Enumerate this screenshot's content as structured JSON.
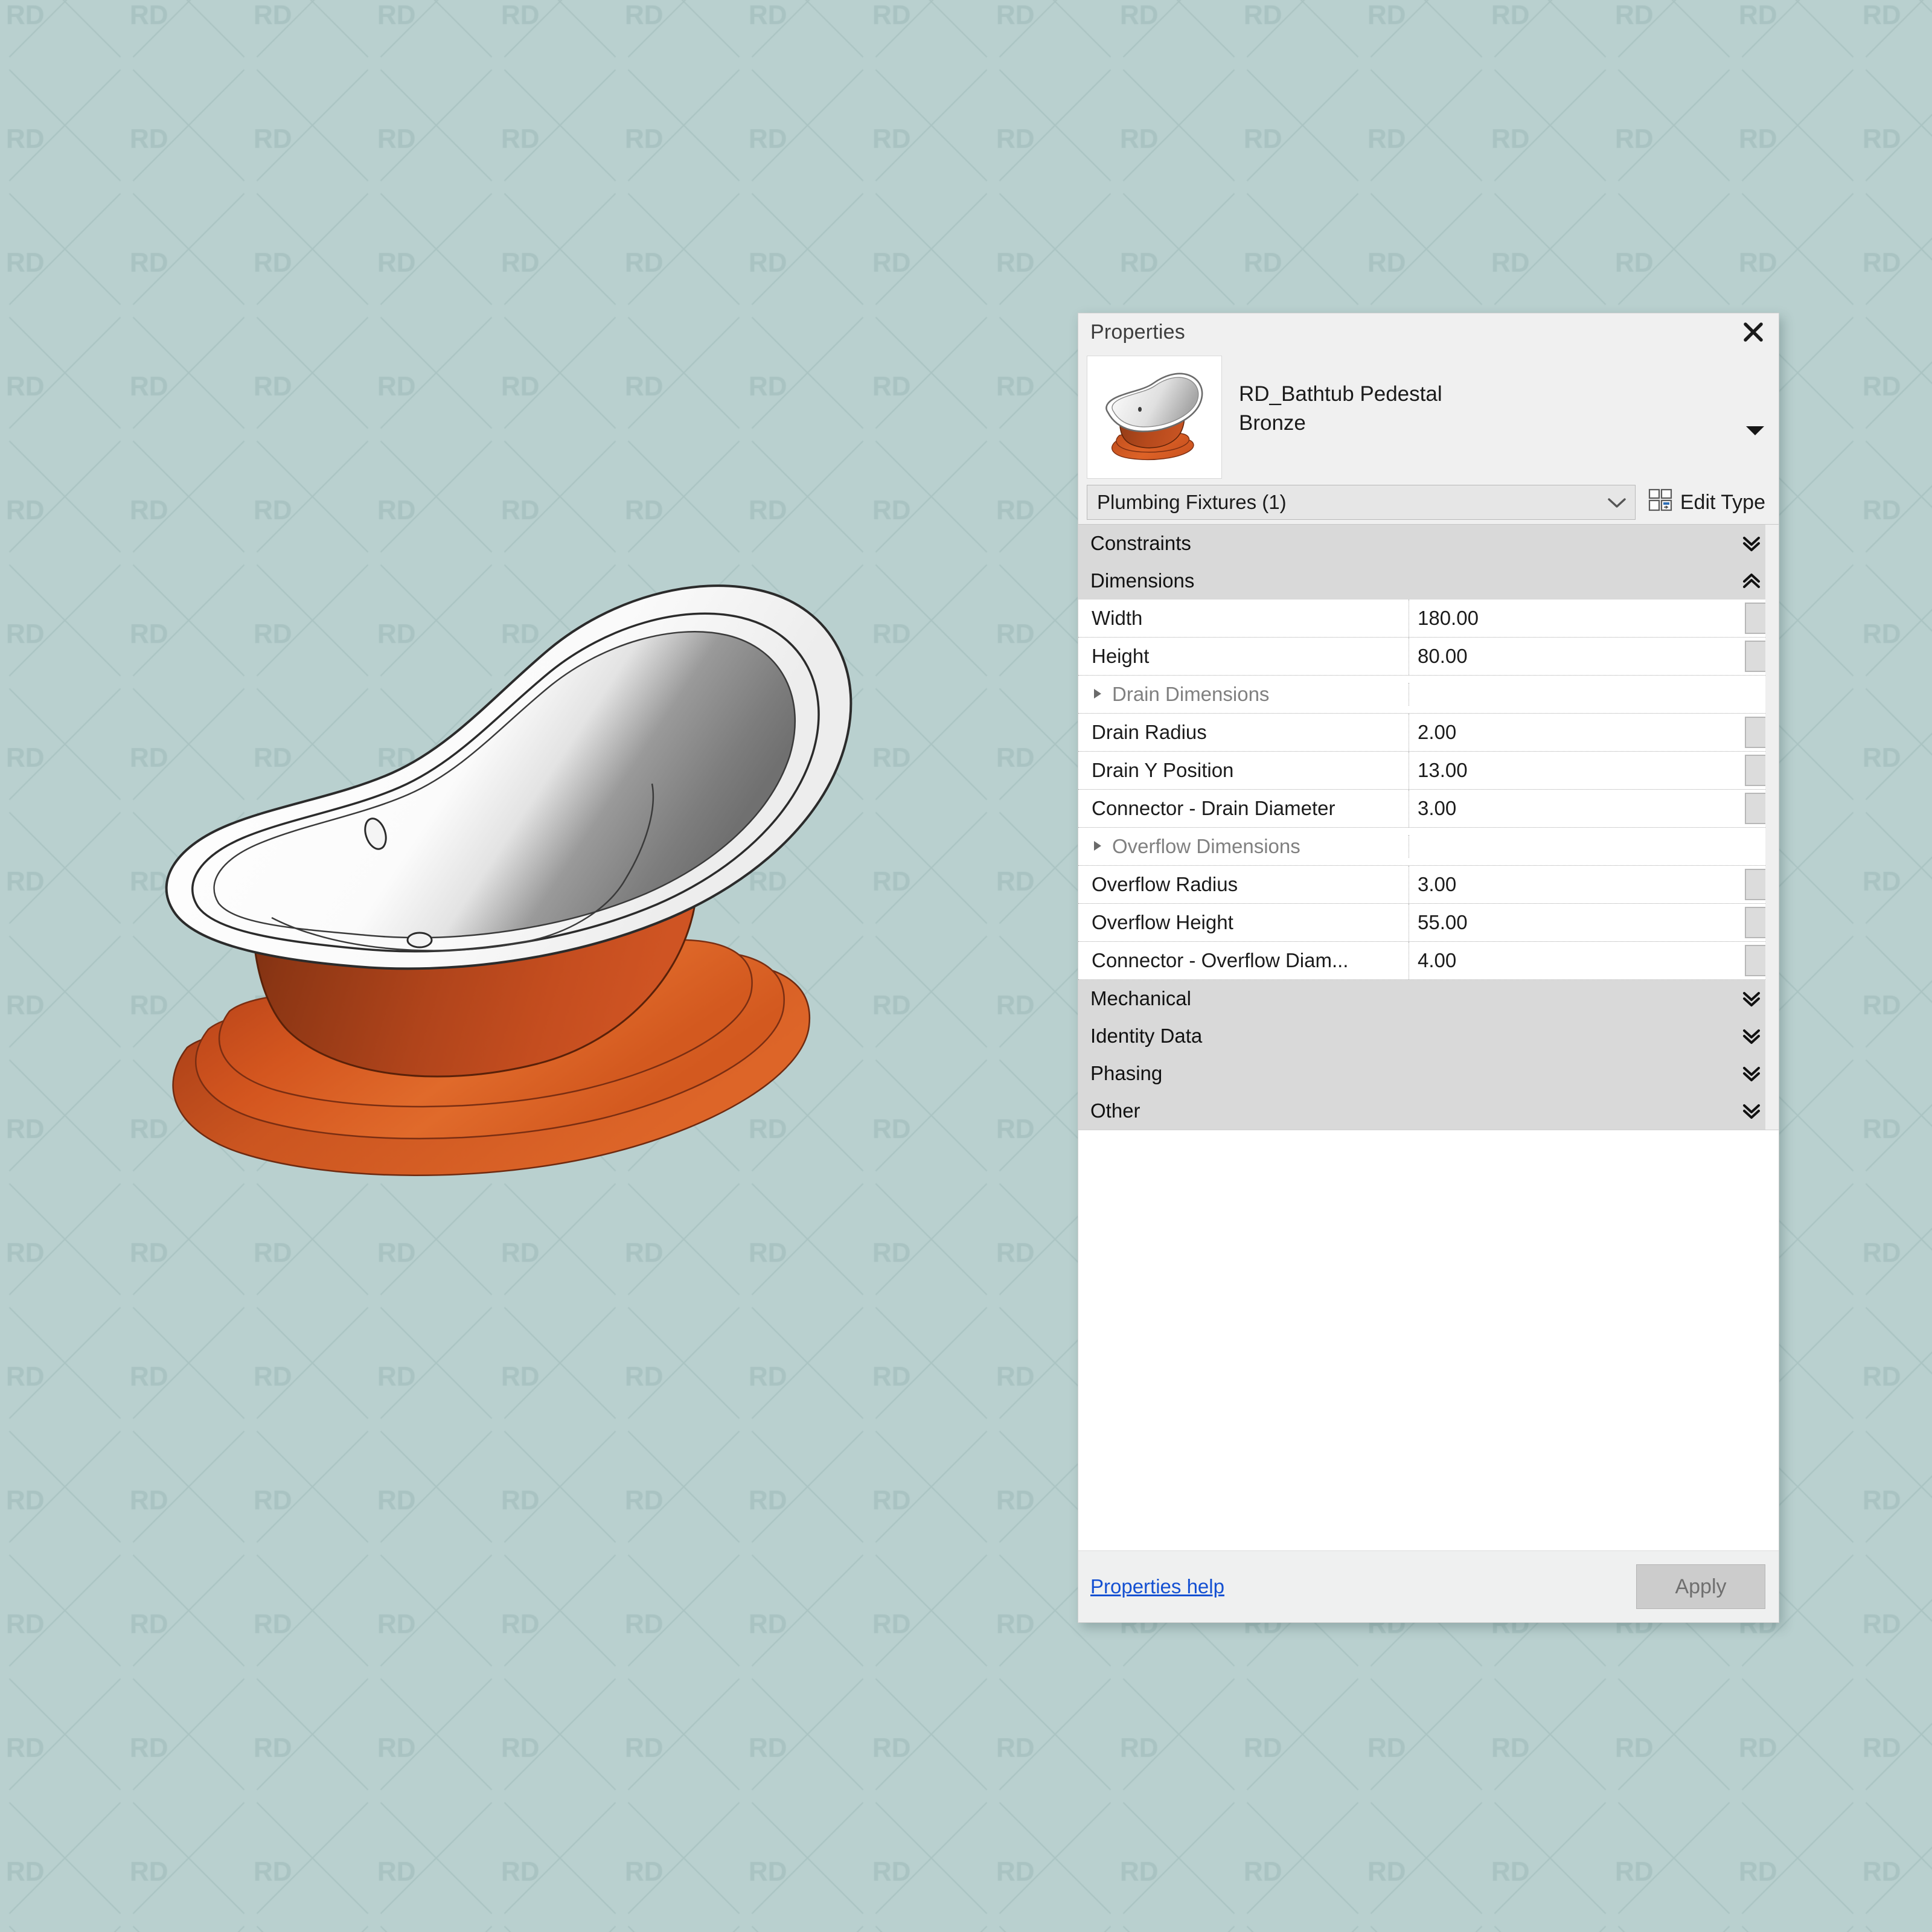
{
  "background": {
    "color": "#b9d0cf",
    "watermark_text": "RD",
    "watermark_color": "#a9c3c2"
  },
  "viewport": {
    "model_name": "RD_Bathtub Pedestal Bronze",
    "tub_body_color": "#c6491f",
    "tub_shadow_color": "#8c3212",
    "tub_interior_color": "#ffffff",
    "tub_interior_shade": "#808080"
  },
  "panel": {
    "title": "Properties",
    "close_icon": "close-icon",
    "type_name_line1": "RD_Bathtub Pedestal",
    "type_name_line2": "Bronze",
    "type_dropdown_icon": "triangle-down-icon",
    "category_selector": {
      "value": "Plumbing Fixtures (1)",
      "chevron_icon": "chevron-down-icon"
    },
    "edit_type": {
      "label": "Edit Type",
      "icon": "edit-type-icon"
    },
    "groups": [
      {
        "name": "Constraints",
        "state": "collapsed",
        "chevron_icon": "chevron-double-down-icon",
        "rows": []
      },
      {
        "name": "Dimensions",
        "state": "expanded",
        "chevron_icon": "chevron-double-up-icon",
        "rows": [
          {
            "kind": "param",
            "name": "Width",
            "value": "180.00",
            "has_assoc_button": true
          },
          {
            "kind": "param",
            "name": "Height",
            "value": "80.00",
            "has_assoc_button": true
          },
          {
            "kind": "sub",
            "name": "Drain Dimensions",
            "expander_icon": "triangle-right-icon"
          },
          {
            "kind": "param",
            "name": "Drain Radius",
            "value": "2.00",
            "has_assoc_button": true
          },
          {
            "kind": "param",
            "name": "Drain Y Position",
            "value": "13.00",
            "has_assoc_button": true
          },
          {
            "kind": "param",
            "name": "Connector - Drain Diameter",
            "value": "3.00",
            "has_assoc_button": true
          },
          {
            "kind": "sub",
            "name": "Overflow Dimensions",
            "expander_icon": "triangle-right-icon"
          },
          {
            "kind": "param",
            "name": "Overflow Radius",
            "value": "3.00",
            "has_assoc_button": true
          },
          {
            "kind": "param",
            "name": "Overflow Height",
            "value": "55.00",
            "has_assoc_button": true
          },
          {
            "kind": "param",
            "name": "Connector - Overflow Diam...",
            "value": "4.00",
            "has_assoc_button": true
          }
        ]
      },
      {
        "name": "Mechanical",
        "state": "collapsed",
        "chevron_icon": "chevron-double-down-icon",
        "rows": []
      },
      {
        "name": "Identity Data",
        "state": "collapsed",
        "chevron_icon": "chevron-double-down-icon",
        "rows": []
      },
      {
        "name": "Phasing",
        "state": "collapsed",
        "chevron_icon": "chevron-double-down-icon",
        "rows": []
      },
      {
        "name": "Other",
        "state": "collapsed",
        "chevron_icon": "chevron-double-down-icon",
        "rows": []
      }
    ],
    "footer": {
      "help_label": "Properties help",
      "apply_label": "Apply"
    }
  }
}
